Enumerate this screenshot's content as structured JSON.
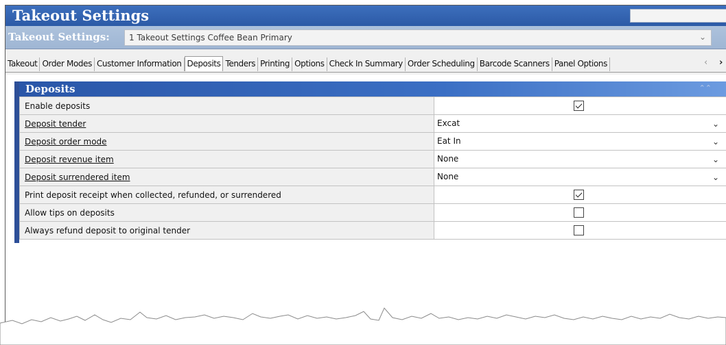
{
  "window": {
    "title": "Takeout Settings"
  },
  "selector": {
    "label": "Takeout Settings:",
    "value": "1 Takeout Settings Coffee Bean Primary"
  },
  "tabs": [
    {
      "label": "Takeout"
    },
    {
      "label": "Order Modes"
    },
    {
      "label": "Customer Information"
    },
    {
      "label": "Deposits",
      "active": true
    },
    {
      "label": "Tenders"
    },
    {
      "label": "Printing"
    },
    {
      "label": "Options"
    },
    {
      "label": "Check In Summary"
    },
    {
      "label": "Order Scheduling"
    },
    {
      "label": "Barcode Scanners"
    },
    {
      "label": "Panel Options"
    }
  ],
  "group": {
    "title": "Deposits"
  },
  "rows": [
    {
      "label": "Enable deposits",
      "type": "checkbox",
      "checked": true,
      "link": false
    },
    {
      "label": "Deposit tender",
      "type": "dropdown",
      "value": "Excat",
      "link": true
    },
    {
      "label": "Deposit order mode",
      "type": "dropdown",
      "value": "Eat In",
      "link": true
    },
    {
      "label": "Deposit revenue item",
      "type": "dropdown",
      "value": "None",
      "link": true
    },
    {
      "label": "Deposit surrendered item",
      "type": "dropdown",
      "value": "None",
      "link": true
    },
    {
      "label": "Print deposit receipt when collected, refunded, or surrendered",
      "type": "checkbox",
      "checked": true,
      "link": false
    },
    {
      "label": "Allow tips on deposits",
      "type": "checkbox",
      "checked": false,
      "link": false
    },
    {
      "label": "Always refund deposit to original tender",
      "type": "checkbox",
      "checked": false,
      "link": false
    }
  ],
  "colors": {
    "titlebar": "#2c5aa6",
    "selectorbar": "#a6bcd9",
    "group_header": "#3b6fc4",
    "group_leftbar": "#2d4f98"
  }
}
